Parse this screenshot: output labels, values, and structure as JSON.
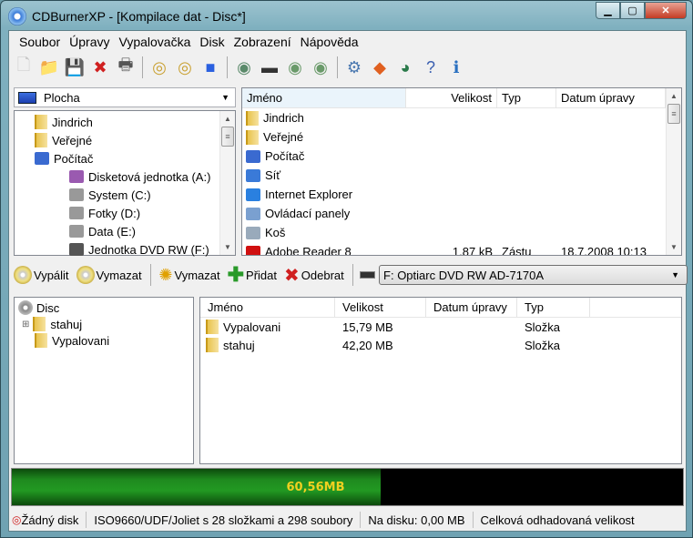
{
  "window": {
    "title": "CDBurnerXP - [Kompilace dat - Disc*]",
    "minimize": "▁",
    "maximize": "▢",
    "close": "✕"
  },
  "menu": [
    "Soubor",
    "Úpravy",
    "Vypalovačka",
    "Disk",
    "Zobrazení",
    "Nápověda"
  ],
  "toolbar": [
    {
      "icon": "new-icon",
      "glyph": "🗋",
      "color": "#c8c8c8"
    },
    {
      "icon": "open-folder-icon",
      "glyph": "📁",
      "color": "#e5c050"
    },
    {
      "icon": "save-icon",
      "glyph": "💾",
      "color": "#3a5fa0"
    },
    {
      "icon": "delete-icon",
      "glyph": "✖",
      "color": "#d02020"
    },
    {
      "icon": "print-icon",
      "glyph": "🖶",
      "color": "#555"
    },
    {
      "sep": true
    },
    {
      "icon": "disc-erase-icon",
      "glyph": "◎",
      "color": "#c9a030"
    },
    {
      "icon": "disc-check-icon",
      "glyph": "◎",
      "color": "#c9a030"
    },
    {
      "icon": "minimize-blue-icon",
      "glyph": "■",
      "color": "#2a60e0"
    },
    {
      "sep": true
    },
    {
      "icon": "disc-info-icon",
      "glyph": "◉",
      "color": "#5a8a6a"
    },
    {
      "icon": "drive-info-icon",
      "glyph": "▬",
      "color": "#333"
    },
    {
      "icon": "disc-down-icon",
      "glyph": "◉",
      "color": "#6a9a6a"
    },
    {
      "icon": "disc-up-icon",
      "glyph": "◉",
      "color": "#6a9a6a"
    },
    {
      "sep": true
    },
    {
      "icon": "settings-icon",
      "glyph": "⚙",
      "color": "#4a78b0"
    },
    {
      "icon": "web-update-icon",
      "glyph": "◆",
      "color": "#e06020"
    },
    {
      "icon": "web-link-icon",
      "glyph": "◕",
      "color": "#2a7a4a"
    },
    {
      "icon": "help-icon",
      "glyph": "?",
      "color": "#3a5fb0"
    },
    {
      "icon": "info-icon",
      "glyph": "ℹ",
      "color": "#2a70c0"
    }
  ],
  "location": {
    "value": "Plocha"
  },
  "folder_tree": [
    {
      "label": "Jindrich",
      "indent": 0,
      "icon": "folder"
    },
    {
      "label": "Veřejné",
      "indent": 0,
      "icon": "folder"
    },
    {
      "label": "Počítač",
      "indent": 0,
      "icon": "computer"
    },
    {
      "label": "Disketová jednotka (A:)",
      "indent": 1,
      "icon": "floppy"
    },
    {
      "label": "System (C:)",
      "indent": 1,
      "icon": "drive"
    },
    {
      "label": "Fotky (D:)",
      "indent": 1,
      "icon": "drive"
    },
    {
      "label": "Data (E:)",
      "indent": 1,
      "icon": "drive"
    },
    {
      "label": "Jednotka DVD RW (F:)",
      "indent": 1,
      "icon": "dvd"
    }
  ],
  "file_browser": {
    "columns": [
      "Jméno",
      "Velikost",
      "Typ",
      "Datum úpravy"
    ],
    "rows": [
      {
        "name": "Jindrich",
        "size": "",
        "type": "",
        "date": "",
        "icon": "folder"
      },
      {
        "name": "Veřejné",
        "size": "",
        "type": "",
        "date": "",
        "icon": "folder"
      },
      {
        "name": "Počítač",
        "size": "",
        "type": "",
        "date": "",
        "icon": "computer"
      },
      {
        "name": "Síť",
        "size": "",
        "type": "",
        "date": "",
        "icon": "network"
      },
      {
        "name": "Internet Explorer",
        "size": "",
        "type": "",
        "date": "",
        "icon": "ie"
      },
      {
        "name": "Ovládací panely",
        "size": "",
        "type": "",
        "date": "",
        "icon": "control-panel"
      },
      {
        "name": "Koš",
        "size": "",
        "type": "",
        "date": "",
        "icon": "recycle-bin"
      },
      {
        "name": "Adobe Reader 8",
        "size": "1,87 kB",
        "type": "Zástu",
        "date": "18.7.2008 10:13",
        "icon": "pdf"
      }
    ]
  },
  "actions": {
    "burn": "Vypálit",
    "erase": "Vymazat",
    "clear": "Vymazat",
    "add": "Přidat",
    "remove": "Odebrat",
    "drive": "F: Optiarc DVD RW AD-7170A"
  },
  "compilation_tree": [
    {
      "label": "Disc",
      "indent": 0
    },
    {
      "label": "stahuj",
      "indent": 1,
      "expander": "+"
    },
    {
      "label": "Vypalovani",
      "indent": 1
    }
  ],
  "compilation_list": {
    "columns": [
      "Jméno",
      "Velikost",
      "Datum úpravy",
      "Typ"
    ],
    "rows": [
      {
        "name": "Vypalovani",
        "size": "15,79 MB",
        "date": "",
        "type": "Složka"
      },
      {
        "name": "stahuj",
        "size": "42,20 MB",
        "date": "",
        "type": "Složka"
      }
    ]
  },
  "capacity": {
    "label": "60,56MB",
    "fraction": 0.55
  },
  "status": {
    "disc": "Žádný disk",
    "fs": "ISO9660/UDF/Joliet s 28 složkami a 298 soubory",
    "on_disc": "Na disku: 0,00 MB",
    "estimated": "Celková odhadovaná velikost"
  }
}
